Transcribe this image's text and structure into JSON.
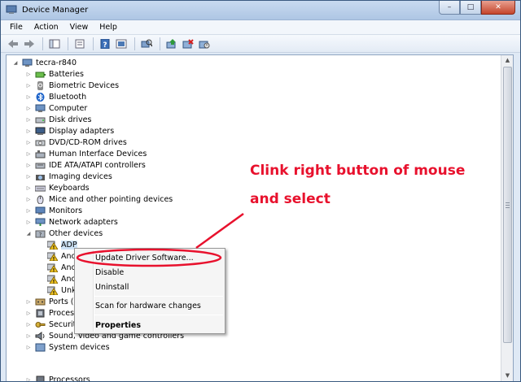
{
  "window": {
    "title": "Device Manager",
    "buttons": {
      "minimize": "–",
      "maximize": "□",
      "close": "✕"
    }
  },
  "menu": [
    "File",
    "Action",
    "View",
    "Help"
  ],
  "toolbar": [
    "back-icon",
    "forward-icon",
    "console-tree-icon",
    "properties-icon",
    "help-icon",
    "view-icon",
    "scan-hardware-icon",
    "update-driver-icon",
    "uninstall-icon",
    "disable-icon"
  ],
  "tree": {
    "root": "tecra-r840",
    "items": [
      "Batteries",
      "Biometric Devices",
      "Bluetooth",
      "Computer",
      "Disk drives",
      "Display adapters",
      "DVD/CD-ROM drives",
      "Human Interface Devices",
      "IDE ATA/ATAPI controllers",
      "Imaging devices",
      "Keyboards",
      "Mice and other pointing devices",
      "Monitors",
      "Network adapters",
      "Other devices"
    ],
    "other_devices_children": [
      "ADP",
      "Anc",
      "Anc",
      "Anc",
      "Unk"
    ],
    "after": [
      "Ports (C",
      "Process",
      "Security",
      "Sound, video and game controllers",
      "System devices",
      "Processors"
    ]
  },
  "context_menu": {
    "update": "Update Driver Software...",
    "disable": "Disable",
    "uninstall": "Uninstall",
    "scan": "Scan for hardware changes",
    "properties": "Properties"
  },
  "annotation": {
    "line1": "Clink right button of mouse",
    "line2": "and select"
  },
  "colors": {
    "annotation": "#e8112d",
    "highlight_ellipse": "#e8112d"
  }
}
